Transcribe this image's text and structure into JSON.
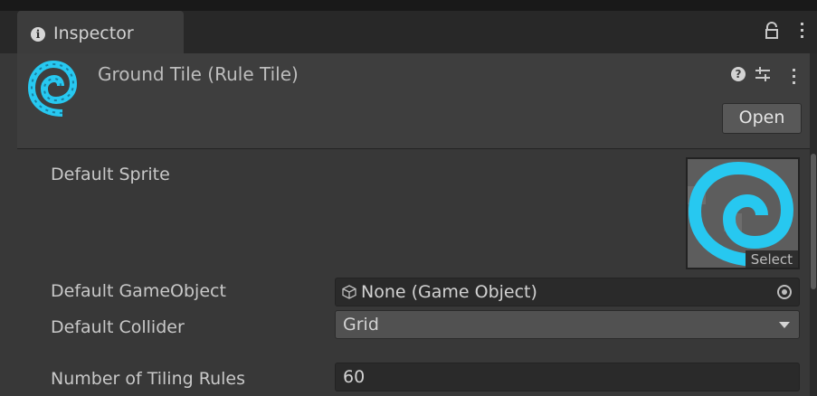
{
  "tab": {
    "icon": "info-icon",
    "label": "Inspector"
  },
  "toolbar": {
    "lock_icon": "lock-icon",
    "menu_icon": "kebab-menu-icon"
  },
  "header": {
    "icon": "rule-tile-swirl-icon",
    "title": "Ground Tile (Rule Tile)",
    "help_icon": "help-icon",
    "help_glyph": "?",
    "presets_icon": "presets-sliders-icon",
    "menu_icon": "kebab-menu-icon",
    "open_label": "Open"
  },
  "fields": {
    "default_sprite": {
      "label": "Default Sprite",
      "select_label": "Select",
      "preview_icon": "swirl-sprite-icon"
    },
    "default_gameobject": {
      "label": "Default GameObject",
      "value": "None (Game Object)",
      "icon": "cube-icon",
      "picker_icon": "object-picker-icon"
    },
    "default_collider": {
      "label": "Default Collider",
      "value": "Grid"
    },
    "tiling_rules": {
      "label": "Number of Tiling Rules",
      "value": "60"
    }
  },
  "colors": {
    "accent": "#27c8f0",
    "panel": "#383838",
    "header": "#3e3e3e",
    "field": "#2a2a2a"
  }
}
